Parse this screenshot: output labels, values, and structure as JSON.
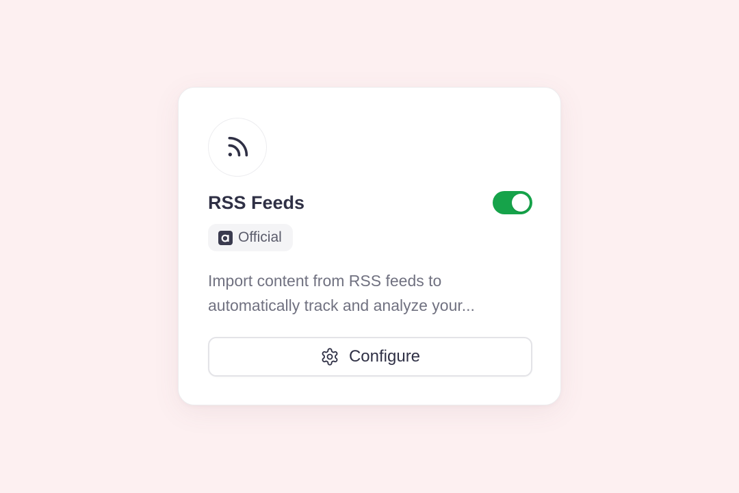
{
  "card": {
    "icon": "rss-icon",
    "title": "RSS Feeds",
    "toggle": {
      "enabled": true,
      "color": "#16a34a"
    },
    "badge": {
      "icon": "official-logo-icon",
      "label": "Official"
    },
    "description": {
      "line1": "Import content from RSS feeds to",
      "line2": "automatically track and analyze your..."
    },
    "configure_button": {
      "icon": "gear-icon",
      "label": "Configure"
    }
  },
  "colors": {
    "background": "#fdf0f1",
    "card": "#ffffff",
    "text_primary": "#2f3045",
    "text_secondary": "#707180",
    "accent": "#16a34a"
  }
}
